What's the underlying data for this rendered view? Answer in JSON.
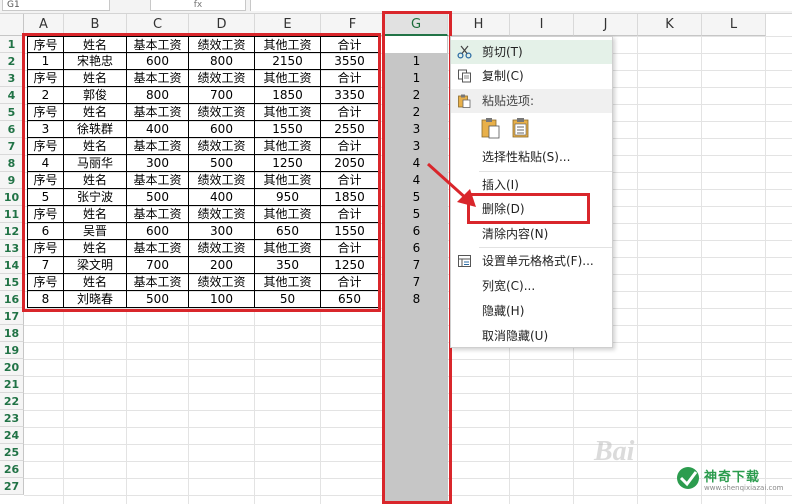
{
  "namebox": {
    "value": "G1"
  },
  "formula_bar": {
    "fx": "fx"
  },
  "columns": [
    "A",
    "B",
    "C",
    "D",
    "E",
    "F",
    "G",
    "H",
    "I",
    "J",
    "K",
    "L"
  ],
  "rows": [
    "1",
    "2",
    "3",
    "4",
    "5",
    "6",
    "7",
    "8",
    "9",
    "10",
    "11",
    "12",
    "13",
    "14",
    "15",
    "16",
    "17",
    "18",
    "19",
    "20",
    "21",
    "22",
    "23",
    "24",
    "25",
    "26",
    "27"
  ],
  "table": {
    "rows": [
      [
        "序号",
        "姓名",
        "基本工资",
        "绩效工资",
        "其他工资",
        "合计"
      ],
      [
        "1",
        "宋艳忠",
        "600",
        "800",
        "2150",
        "3550"
      ],
      [
        "序号",
        "姓名",
        "基本工资",
        "绩效工资",
        "其他工资",
        "合计"
      ],
      [
        "2",
        "郭俊",
        "800",
        "700",
        "1850",
        "3350"
      ],
      [
        "序号",
        "姓名",
        "基本工资",
        "绩效工资",
        "其他工资",
        "合计"
      ],
      [
        "3",
        "徐轶群",
        "400",
        "600",
        "1550",
        "2550"
      ],
      [
        "序号",
        "姓名",
        "基本工资",
        "绩效工资",
        "其他工资",
        "合计"
      ],
      [
        "4",
        "马丽华",
        "300",
        "500",
        "1250",
        "2050"
      ],
      [
        "序号",
        "姓名",
        "基本工资",
        "绩效工资",
        "其他工资",
        "合计"
      ],
      [
        "5",
        "张宁波",
        "500",
        "400",
        "950",
        "1850"
      ],
      [
        "序号",
        "姓名",
        "基本工资",
        "绩效工资",
        "其他工资",
        "合计"
      ],
      [
        "6",
        "吴晋",
        "600",
        "300",
        "650",
        "1550"
      ],
      [
        "序号",
        "姓名",
        "基本工资",
        "绩效工资",
        "其他工资",
        "合计"
      ],
      [
        "7",
        "梁文明",
        "700",
        "200",
        "350",
        "1250"
      ],
      [
        "序号",
        "姓名",
        "基本工资",
        "绩效工资",
        "其他工资",
        "合计"
      ],
      [
        "8",
        "刘晓春",
        "500",
        "100",
        "50",
        "650"
      ]
    ]
  },
  "column_g": [
    "",
    "1",
    "1",
    "2",
    "2",
    "3",
    "3",
    "4",
    "4",
    "5",
    "5",
    "6",
    "6",
    "7",
    "7",
    "8"
  ],
  "context_menu": {
    "cut": "剪切(T)",
    "copy": "复制(C)",
    "paste_options": "粘贴选项:",
    "paste_special": "选择性粘贴(S)...",
    "insert": "插入(I)",
    "delete": "删除(D)",
    "clear_contents": "清除内容(N)",
    "format_cells": "设置单元格格式(F)...",
    "column_width": "列宽(C)...",
    "hide": "隐藏(H)",
    "unhide": "取消隐藏(U)"
  },
  "colors": {
    "highlight_red": "#d9262b",
    "selection_gray": "#c6c6c6",
    "accent_green": "#217346"
  },
  "watermark": {
    "brand": "神奇下载",
    "site": "www.shenqixiazai.com",
    "faint": "Bai"
  }
}
